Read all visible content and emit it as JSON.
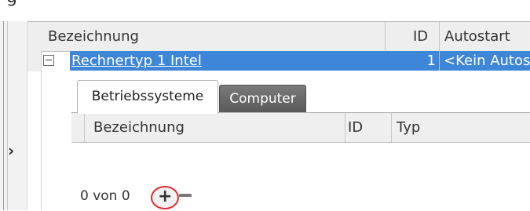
{
  "window": {
    "title_fragment": "g"
  },
  "grid": {
    "columns": [
      "Bezeichnung",
      "ID",
      "Autostart"
    ],
    "selected_row": {
      "name": "Rechnertyp 1 Intel",
      "id": "1",
      "autostart": "<Kein Autos"
    }
  },
  "detail": {
    "tabs": [
      "Betriebssysteme",
      "Computer"
    ],
    "active_tab": "Betriebssysteme",
    "sub_grid": {
      "columns": [
        "Bezeichnung",
        "ID",
        "Typ"
      ]
    },
    "navigator": {
      "record_text": "0 von 0",
      "add_symbol": "+",
      "highlight_color": "#e52b2b"
    }
  },
  "colors": {
    "selection": "#3d86d8",
    "header_bg": "#eeeeee",
    "inactive_tab": "#5a5a5a"
  },
  "icons": {
    "row_indicator": "chevron-right-icon",
    "expander": "collapse-minus-icon",
    "remove": "minus-icon"
  }
}
